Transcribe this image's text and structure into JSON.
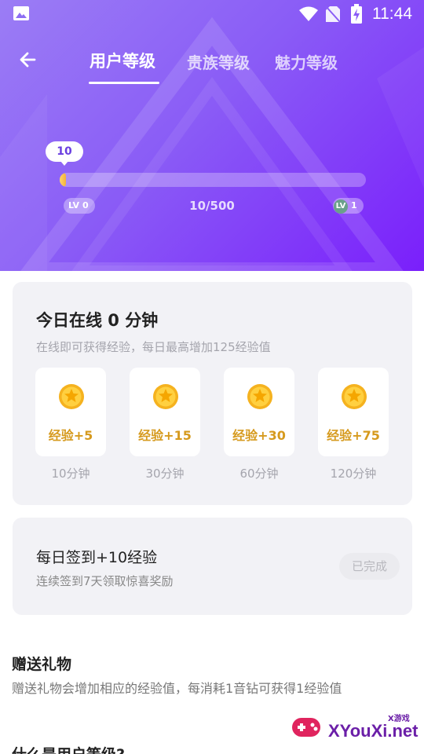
{
  "status_bar": {
    "time": "11:44"
  },
  "nav": {
    "tabs": [
      {
        "label": "用户等级",
        "active": true
      },
      {
        "label": "贵族等级",
        "active": false
      },
      {
        "label": "魅力等级",
        "active": false
      }
    ]
  },
  "level": {
    "current_exp_bubble": "10",
    "progress_text": "10/500",
    "progress_fraction": 0.02,
    "left_badge_prefix": "LV",
    "left_badge_num": "0",
    "right_badge_prefix": "LV",
    "right_badge_num": "1"
  },
  "online_card": {
    "title": "今日在线 0 分钟",
    "subtitle": "在线即可获得经验，每日最高增加125经验值",
    "rewards": [
      {
        "label": "经验+5",
        "time": "10分钟"
      },
      {
        "label": "经验+15",
        "time": "30分钟"
      },
      {
        "label": "经验+30",
        "time": "60分钟"
      },
      {
        "label": "经验+75",
        "time": "120分钟"
      }
    ]
  },
  "checkin_card": {
    "title": "每日签到+10经验",
    "subtitle": "连续签到7天领取惊喜奖励",
    "button": "已完成"
  },
  "gift_section": {
    "title": "赠送礼物",
    "desc": "赠送礼物会增加相应的经验值，每消耗1音钻可获得1经验值"
  },
  "faq_section": {
    "title": "什么是用户等级?"
  },
  "watermark": {
    "text": "XYouXi.net",
    "tag": "X游戏"
  },
  "colors": {
    "accent": "#7a1ffb",
    "reward_text": "#d69a1e",
    "card_bg": "#f2f2f6"
  },
  "icons": [
    "gallery-icon",
    "wifi-icon",
    "no-sim-icon",
    "battery-charging-icon",
    "back-arrow-icon",
    "exp-coin-icon"
  ]
}
